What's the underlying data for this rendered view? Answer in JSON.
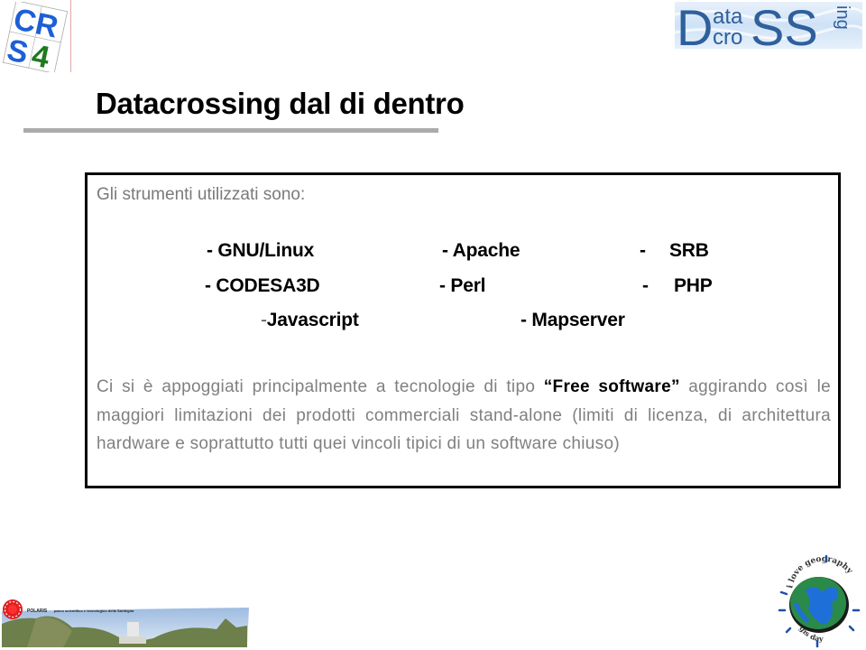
{
  "slide": {
    "title": "Datacrossing dal di dentro",
    "intro": "Gli strumenti utilizzati sono:",
    "tools": {
      "row1": [
        "- GNU/Linux",
        "- Apache",
        "-",
        "SRB"
      ],
      "row2": [
        "- CODESA3D",
        "- Perl",
        "-",
        "PHP"
      ],
      "row3": [
        "-",
        "Javascript",
        "- Mapserver"
      ]
    },
    "paragraph": {
      "before": "Ci si è appoggiati principalmente a tecnologie di tipo ",
      "highlight": "“Free software”",
      "after": " aggirando così le maggiori limitazioni dei prodotti commerciali stand-alone (limiti di licenza, di architettura hardware e soprattutto tutti quei vincoli tipici di un software chiuso)"
    }
  },
  "logos": {
    "crs4": {
      "text_top": "CR",
      "text_bottom_left": "S",
      "text_bottom_right": "4",
      "blue": "#1d5fd6",
      "green": "#1e7a1e"
    },
    "datacrossing": {
      "big_d": "D",
      "top": "ata",
      "bottom": "cro",
      "ss": "SS",
      "side": "ing",
      "color": "#2f5f9c"
    },
    "polaris": {
      "name": "POLARIS",
      "tagline": "parco scientifico e tecnologico della Sardegna",
      "red": "#e02020"
    },
    "globe": {
      "top_text": "i love geography",
      "bottom_text": "gis day"
    }
  }
}
